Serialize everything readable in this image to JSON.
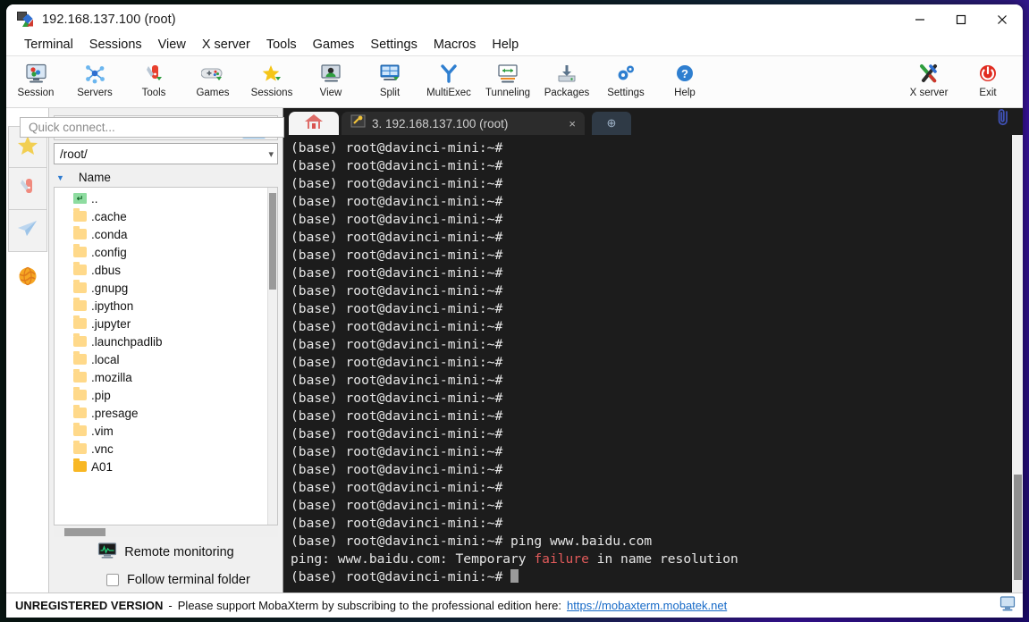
{
  "window": {
    "title": "192.168.137.100 (root)",
    "app_icon": "mobaxterm-icon",
    "minimize_label": "Minimize",
    "maximize_label": "Maximize",
    "close_label": "Close"
  },
  "menubar": {
    "items": [
      {
        "label": "Terminal"
      },
      {
        "label": "Sessions"
      },
      {
        "label": "View"
      },
      {
        "label": "X server"
      },
      {
        "label": "Tools"
      },
      {
        "label": "Games"
      },
      {
        "label": "Settings"
      },
      {
        "label": "Macros"
      },
      {
        "label": "Help"
      }
    ]
  },
  "toolbar": {
    "left_buttons": [
      {
        "label": "Session",
        "icon": "session-monitor-icon"
      },
      {
        "label": "Servers",
        "icon": "servers-network-icon"
      },
      {
        "label": "Tools",
        "icon": "tools-knife-icon"
      },
      {
        "label": "Games",
        "icon": "games-gamepad-icon"
      },
      {
        "label": "Sessions",
        "icon": "sessions-star-icon"
      },
      {
        "label": "View",
        "icon": "view-monitor-icon"
      },
      {
        "label": "Split",
        "icon": "split-panes-icon"
      },
      {
        "label": "MultiExec",
        "icon": "multiexec-fork-icon"
      },
      {
        "label": "Tunneling",
        "icon": "tunneling-icon"
      },
      {
        "label": "Packages",
        "icon": "packages-download-icon"
      },
      {
        "label": "Settings",
        "icon": "settings-gear-icon"
      },
      {
        "label": "Help",
        "icon": "help-question-icon"
      }
    ],
    "right_buttons": [
      {
        "label": "X server",
        "icon": "x-server-icon"
      },
      {
        "label": "Exit",
        "icon": "exit-power-icon"
      }
    ]
  },
  "quick_connect": {
    "placeholder": "Quick connect...",
    "value": ""
  },
  "rail": {
    "items": [
      {
        "name": "bookmarks",
        "icon": "star-icon"
      },
      {
        "name": "tools",
        "icon": "swiss-knife-icon"
      },
      {
        "name": "sftp",
        "icon": "paper-plane-icon"
      },
      {
        "name": "macros",
        "icon": "globe-icon"
      }
    ]
  },
  "sftp": {
    "toolbar_icons": [
      {
        "name": "parent-folder-icon",
        "active": false
      },
      {
        "name": "download-icon",
        "active": false
      },
      {
        "name": "upload-icon",
        "active": false
      },
      {
        "name": "refresh-icon",
        "active": false
      },
      {
        "name": "new-folder-icon",
        "active": false
      },
      {
        "name": "new-file-icon",
        "active": false
      },
      {
        "name": "delete-icon",
        "active": false
      },
      {
        "name": "text-mode-icon",
        "active": false
      },
      {
        "name": "bookmark-panel-icon",
        "active": true
      }
    ],
    "path": "/root/",
    "column_header": "Name",
    "files": [
      {
        "name": "..",
        "type": "parent"
      },
      {
        "name": ".cache",
        "type": "folder"
      },
      {
        "name": ".conda",
        "type": "folder"
      },
      {
        "name": ".config",
        "type": "folder"
      },
      {
        "name": ".dbus",
        "type": "folder"
      },
      {
        "name": ".gnupg",
        "type": "folder"
      },
      {
        "name": ".ipython",
        "type": "folder"
      },
      {
        "name": ".jupyter",
        "type": "folder"
      },
      {
        "name": ".launchpadlib",
        "type": "folder"
      },
      {
        "name": ".local",
        "type": "folder"
      },
      {
        "name": ".mozilla",
        "type": "folder"
      },
      {
        "name": ".pip",
        "type": "folder"
      },
      {
        "name": ".presage",
        "type": "folder"
      },
      {
        "name": ".vim",
        "type": "folder"
      },
      {
        "name": ".vnc",
        "type": "folder"
      },
      {
        "name": "A01",
        "type": "folder-dark"
      }
    ],
    "remote_monitoring_label": "Remote monitoring",
    "follow_terminal_label": "Follow terminal folder",
    "follow_terminal_checked": false
  },
  "tabs": {
    "home_label": "",
    "active": {
      "label": "3. 192.168.137.100 (root)",
      "icon": "key-icon",
      "close_label": "×"
    },
    "new_tab_label": "⊕",
    "attachment_icon": "paperclip-icon"
  },
  "terminal": {
    "prompt": "(base) root@davinci-mini:~# ",
    "blank_prompt_count": 22,
    "command_line": {
      "prompt": "(base) root@davinci-mini:~# ",
      "command": "ping www.baidu.com"
    },
    "error_line": {
      "before": "ping: www.baidu.com: Temporary ",
      "highlight": "failure",
      "after": " in name resolution",
      "highlight_color": "#e05a5a"
    },
    "final_prompt": "(base) root@davinci-mini:~# "
  },
  "statusbar": {
    "badge": "UNREGISTERED VERSION",
    "dash": "-",
    "message": "Please support MobaXterm by subscribing to the professional edition here:",
    "link": "https://mobaxterm.mobatek.net",
    "icon": "display-icon"
  },
  "colors": {
    "accent": "#1569c7",
    "terminal_bg": "#1c1c1c",
    "terminal_fg": "#e6e6e6",
    "error": "#e05a5a",
    "folder": "#ffd98a"
  }
}
